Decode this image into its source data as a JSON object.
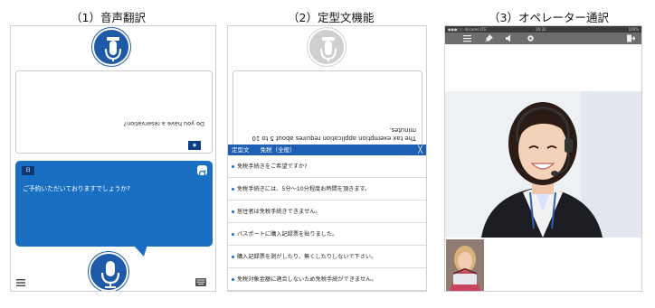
{
  "captions": {
    "panel1": "（1）音声翻訳",
    "panel2": "（2）定型文機能",
    "panel3": "（3）オペレーター通訳"
  },
  "panel1": {
    "english_text": "Do you have a reservation?",
    "jp_tag": "日",
    "japanese_text": "ご予約いただいておりますでしょうか?",
    "colors": {
      "accent": "#1e5aa8",
      "bubble": "#1b6fc2"
    }
  },
  "panel2": {
    "english_text": "The tax exemption application requires about 5 to 10 minutes.",
    "header_label": "定型文",
    "header_category": "免税（全般）",
    "close_glyph": "╳",
    "phrases": [
      "免税手続きをご希望ですか?",
      "免税手続きには、5分〜10分程度お時間を頂きます。",
      "居住者は免税手続きできません。",
      "パスポートに購入記録票を貼りました。",
      "購入記録票を剥がしたり、無くしたりしないで下さい。",
      "免税対象金額に適合しないため免税手続ができません。"
    ]
  },
  "panel3": {
    "status_left": "●●●○○ docomo LTE",
    "status_center": "16:32",
    "status_right": "100%",
    "icons": [
      "menu-icon",
      "pin-icon",
      "speaker-icon",
      "settings-icon",
      "exit-icon"
    ]
  }
}
